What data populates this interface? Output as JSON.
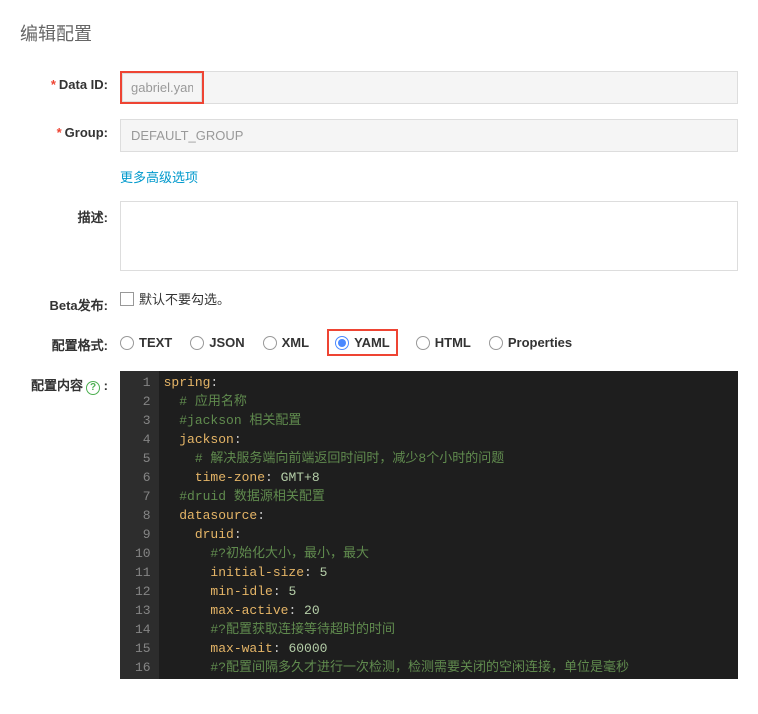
{
  "page": {
    "title": "编辑配置"
  },
  "form": {
    "data_id": {
      "label": "Data ID:",
      "value": "gabriel.yaml"
    },
    "group": {
      "label": "Group:",
      "value": "DEFAULT_GROUP"
    },
    "advanced_link": "更多高级选项",
    "description": {
      "label": "描述:",
      "value": ""
    },
    "beta": {
      "label": "Beta发布:",
      "checkbox_label": "默认不要勾选。"
    },
    "format": {
      "label": "配置格式:",
      "options": [
        "TEXT",
        "JSON",
        "XML",
        "YAML",
        "HTML",
        "Properties"
      ],
      "selected": "YAML"
    },
    "content": {
      "label": "配置内容",
      "help": "?"
    }
  },
  "code": {
    "lines": [
      {
        "n": 1,
        "tokens": [
          {
            "t": "spring",
            "c": "key"
          },
          {
            "t": ":",
            "c": "punct"
          }
        ]
      },
      {
        "n": 2,
        "tokens": [
          {
            "t": "  ",
            "c": ""
          },
          {
            "t": "# 应用名称",
            "c": "comment"
          }
        ]
      },
      {
        "n": 3,
        "tokens": [
          {
            "t": "  ",
            "c": ""
          },
          {
            "t": "#jackson 相关配置",
            "c": "comment"
          }
        ]
      },
      {
        "n": 4,
        "tokens": [
          {
            "t": "  ",
            "c": ""
          },
          {
            "t": "jackson",
            "c": "key"
          },
          {
            "t": ":",
            "c": "punct"
          }
        ]
      },
      {
        "n": 5,
        "tokens": [
          {
            "t": "    ",
            "c": ""
          },
          {
            "t": "# 解决服务端向前端返回时间时，减少8个小时的问题",
            "c": "comment"
          }
        ]
      },
      {
        "n": 6,
        "tokens": [
          {
            "t": "    ",
            "c": ""
          },
          {
            "t": "time-zone",
            "c": "key"
          },
          {
            "t": ": ",
            "c": "punct"
          },
          {
            "t": "GMT+8",
            "c": "value"
          }
        ]
      },
      {
        "n": 7,
        "tokens": [
          {
            "t": "  ",
            "c": ""
          },
          {
            "t": "#druid 数据源相关配置",
            "c": "comment"
          }
        ]
      },
      {
        "n": 8,
        "tokens": [
          {
            "t": "  ",
            "c": ""
          },
          {
            "t": "datasource",
            "c": "key"
          },
          {
            "t": ":",
            "c": "punct"
          }
        ]
      },
      {
        "n": 9,
        "tokens": [
          {
            "t": "    ",
            "c": ""
          },
          {
            "t": "druid",
            "c": "key"
          },
          {
            "t": ":",
            "c": "punct"
          }
        ]
      },
      {
        "n": 10,
        "tokens": [
          {
            "t": "      ",
            "c": ""
          },
          {
            "t": "#?初始化大小，最小，最大",
            "c": "comment"
          }
        ]
      },
      {
        "n": 11,
        "tokens": [
          {
            "t": "      ",
            "c": ""
          },
          {
            "t": "initial-size",
            "c": "key"
          },
          {
            "t": ": ",
            "c": "punct"
          },
          {
            "t": "5",
            "c": "value"
          }
        ]
      },
      {
        "n": 12,
        "tokens": [
          {
            "t": "      ",
            "c": ""
          },
          {
            "t": "min-idle",
            "c": "key"
          },
          {
            "t": ": ",
            "c": "punct"
          },
          {
            "t": "5",
            "c": "value"
          }
        ]
      },
      {
        "n": 13,
        "tokens": [
          {
            "t": "      ",
            "c": ""
          },
          {
            "t": "max-active",
            "c": "key"
          },
          {
            "t": ": ",
            "c": "punct"
          },
          {
            "t": "20",
            "c": "value"
          }
        ]
      },
      {
        "n": 14,
        "tokens": [
          {
            "t": "      ",
            "c": ""
          },
          {
            "t": "#?配置获取连接等待超时的时间",
            "c": "comment"
          }
        ]
      },
      {
        "n": 15,
        "tokens": [
          {
            "t": "      ",
            "c": ""
          },
          {
            "t": "max-wait",
            "c": "key"
          },
          {
            "t": ": ",
            "c": "punct"
          },
          {
            "t": "60000",
            "c": "value"
          }
        ]
      },
      {
        "n": 16,
        "tokens": [
          {
            "t": "      ",
            "c": ""
          },
          {
            "t": "#?配置间隔多久才进行一次检测，检测需要关闭的空闲连接，单位是毫秒",
            "c": "comment"
          }
        ]
      }
    ]
  }
}
